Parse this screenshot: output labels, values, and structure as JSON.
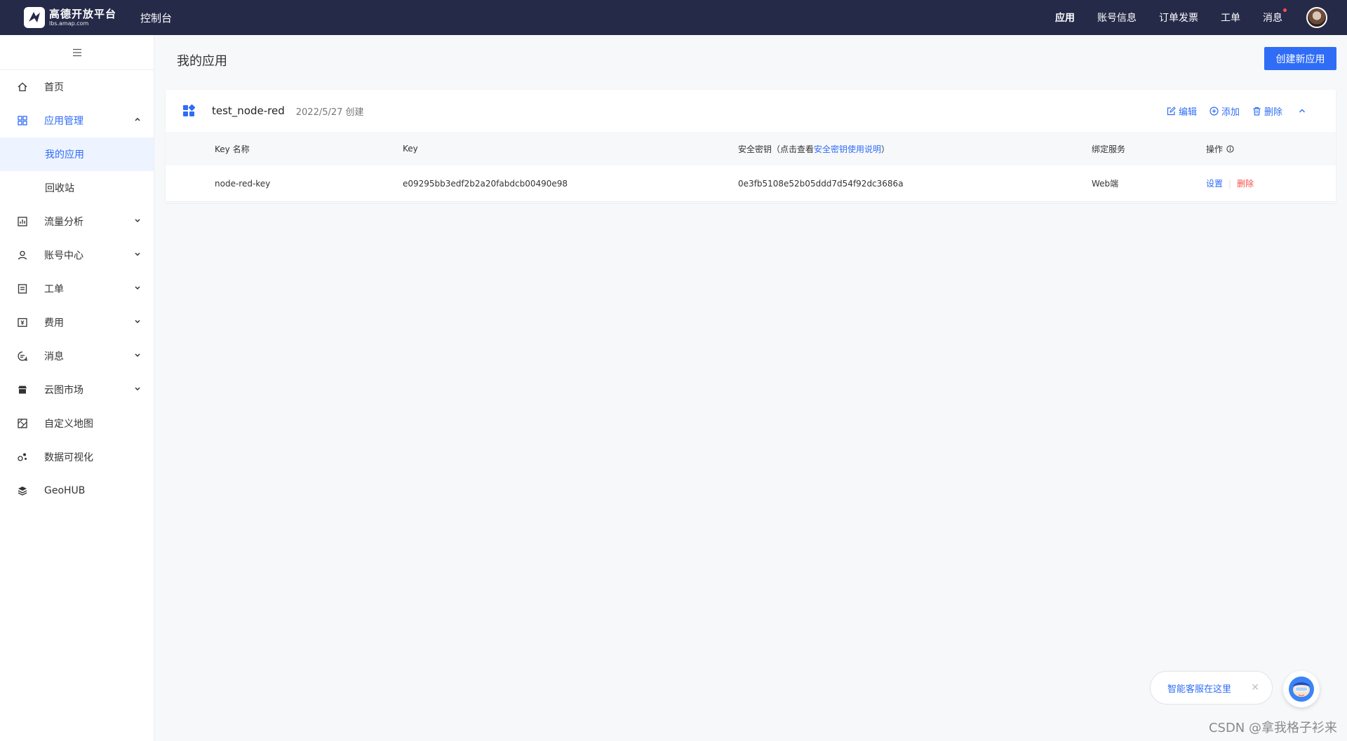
{
  "topbar": {
    "logo_title": "高德开放平台",
    "logo_sub": "lbs.amap.com",
    "console": "控制台",
    "nav": [
      "应用",
      "账号信息",
      "订单发票",
      "工单",
      "消息"
    ],
    "active_nav": "应用"
  },
  "sidebar": {
    "items": [
      {
        "label": "首页",
        "icon": "home-icon"
      },
      {
        "label": "应用管理",
        "icon": "apps-icon",
        "open": true,
        "children": [
          {
            "label": "我的应用",
            "active": true
          },
          {
            "label": "回收站"
          }
        ]
      },
      {
        "label": "流量分析",
        "icon": "analytics-icon"
      },
      {
        "label": "账号中心",
        "icon": "user-icon"
      },
      {
        "label": "工单",
        "icon": "ticket-icon"
      },
      {
        "label": "费用",
        "icon": "billing-icon"
      },
      {
        "label": "消息",
        "icon": "message-icon"
      },
      {
        "label": "云图市场",
        "icon": "store-icon"
      },
      {
        "label": "自定义地图",
        "icon": "custom-map-icon"
      },
      {
        "label": "数据可视化",
        "icon": "visualization-icon"
      },
      {
        "label": "GeoHUB",
        "icon": "layers-icon"
      }
    ]
  },
  "main": {
    "title": "我的应用",
    "create_button": "创建新应用",
    "app": {
      "name": "test_node-red",
      "created": "2022/5/27 创建",
      "actions": {
        "edit": "编辑",
        "add": "添加",
        "delete": "删除"
      },
      "columns": {
        "key_name": "Key 名称",
        "key": "Key",
        "secret_prefix": "安全密钥（点击查看",
        "secret_link": "安全密钥使用说明",
        "secret_suffix": "）",
        "service": "绑定服务",
        "ops": "操作"
      },
      "rows": [
        {
          "key_name": "node-red-key",
          "key": "e09295bb3edf2b2a20fabdcb00490e98",
          "secret": "0e3fb5108e52b05ddd7d54f92dc3686a",
          "service": "Web端",
          "op_settings": "设置",
          "op_delete": "删除"
        }
      ]
    }
  },
  "helper": {
    "text": "智能客服在这里"
  },
  "watermark": "CSDN @拿我格子衫来",
  "colors": {
    "topbar": "#252a48",
    "accent": "#2f6df6",
    "danger": "#f5504a"
  }
}
